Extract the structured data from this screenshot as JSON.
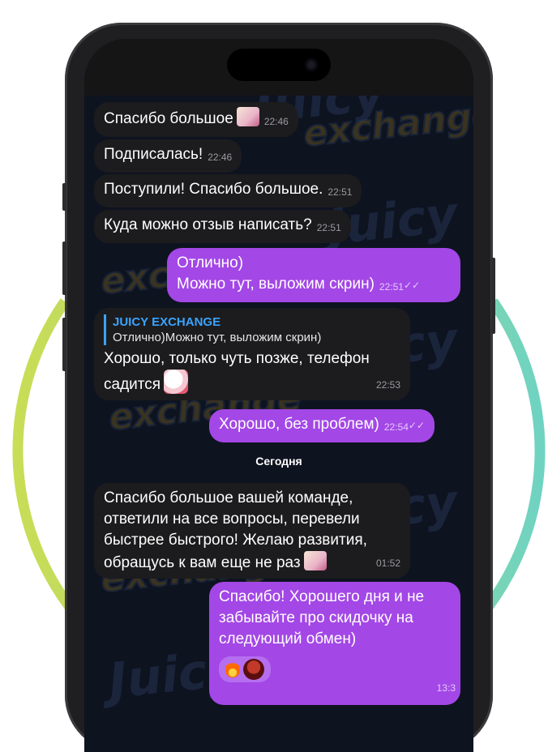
{
  "chat": {
    "messages": [
      {
        "dir": "in",
        "text": "Спасибо большое",
        "time": "22:46",
        "emoji": "envelope-hearts"
      },
      {
        "dir": "in",
        "text": "Подписалась!",
        "time": "22:46"
      },
      {
        "dir": "in",
        "text": "Поступили! Спасибо большое.",
        "time": "22:51"
      },
      {
        "dir": "in",
        "text": "Куда можно отзыв написать?",
        "time": "22:51"
      },
      {
        "dir": "out",
        "line1": "Отлично)",
        "line2": "Можно тут, выложим скрин)",
        "time": "22:51",
        "status": "read"
      },
      {
        "dir": "in",
        "reply_name": "JUICY EXCHANGE",
        "reply_text": "Отлично)Можно тут, выложим скрин)",
        "line1": "Хорошо, только чуть позже, телефон",
        "line2": "садится",
        "time": "22:53",
        "emoji": "cat-sticker"
      },
      {
        "dir": "out",
        "text": "Хорошо, без проблем)",
        "time": "22:54",
        "status": "read"
      },
      {
        "dir": "in",
        "line1": "Спасибо большое вашей команде,",
        "line2": "ответили на все вопросы, перевели",
        "line3": "быстрее быстрого! Желаю развития,",
        "line4": "обращусь к вам еще не раз",
        "time": "01:52",
        "emoji": "envelope-hearts"
      },
      {
        "dir": "out",
        "line1": "Спасибо! Хорошего дня и не",
        "line2": "забывайте про скидочку на",
        "line3": "следующий обмен)",
        "time": "13:3",
        "reactions": [
          "fire-icon",
          "avatar"
        ]
      }
    ],
    "day_separator": "Сегодня",
    "check_mark": "✓✓"
  },
  "wallpaper": {
    "brand_top": "Juicy",
    "brand_bottom": "exchange"
  },
  "colors": {
    "outgoing": "#a347e6",
    "incoming": "#1c1c1e",
    "reply_accent": "#3aa3ff",
    "ring_left": "#c6dc5a",
    "ring_right": "#6dd3c0"
  }
}
